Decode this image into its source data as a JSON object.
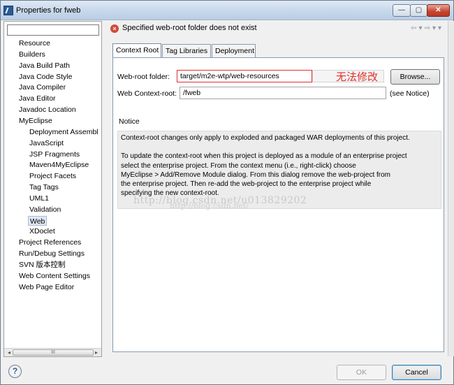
{
  "window": {
    "title": "Properties for fweb",
    "min_glyph": "—",
    "max_glyph": "▢",
    "close_glyph": "✕"
  },
  "sidebar": {
    "filter_placeholder": "",
    "items": [
      {
        "label": "Resource",
        "level": 0
      },
      {
        "label": "Builders",
        "level": 0
      },
      {
        "label": "Java Build Path",
        "level": 0
      },
      {
        "label": "Java Code Style",
        "level": 0
      },
      {
        "label": "Java Compiler",
        "level": 0
      },
      {
        "label": "Java Editor",
        "level": 0
      },
      {
        "label": "Javadoc Location",
        "level": 0
      },
      {
        "label": "MyEclipse",
        "level": 0
      },
      {
        "label": "Deployment Assembl",
        "level": 1
      },
      {
        "label": "JavaScript",
        "level": 1
      },
      {
        "label": "JSP Fragments",
        "level": 1
      },
      {
        "label": "Maven4MyEclipse",
        "level": 1
      },
      {
        "label": "Project Facets",
        "level": 1
      },
      {
        "label": "Tag Tags",
        "level": 1
      },
      {
        "label": "UML1",
        "level": 1
      },
      {
        "label": "Validation",
        "level": 1
      },
      {
        "label": "Web",
        "level": 1,
        "selected": true
      },
      {
        "label": "XDoclet",
        "level": 1
      },
      {
        "label": "Project References",
        "level": 0
      },
      {
        "label": "Run/Debug Settings",
        "level": 0
      },
      {
        "label": "SVN 版本控制",
        "level": 0
      },
      {
        "label": "Web Content Settings",
        "level": 0
      },
      {
        "label": "Web Page Editor",
        "level": 0
      }
    ],
    "scroll_thumb_label": "III"
  },
  "message": {
    "text": "Specified web-root folder does not exist",
    "icon": "error-icon"
  },
  "tabs": [
    "Context Root",
    "Tag Libraries",
    "Deployment"
  ],
  "form": {
    "webroot_label": "Web-root folder:",
    "webroot_value": "target/m2e-wtp/web-resources",
    "annotation": "无法修改",
    "browse_label": "Browse...",
    "context_label": "Web Context-root:",
    "context_value": "/fweb",
    "see_notice": "(see Notice)"
  },
  "notice": {
    "heading": "Notice",
    "lines": [
      "Context-root changes only apply to exploded and packaged WAR deployments of this project.",
      "",
      "To update the context-root when this project is deployed as a module of an enterprise project",
      "select the enterprise project. From the context menu (i.e., right-click) choose",
      "MyEclipse > Add/Remove Module dialog. From this dialog remove the web-project from",
      "the enterprise project. Then re-add the web-project to the enterprise project while",
      "specifying the new context-root."
    ],
    "watermark": "http://blog.csdn.net/u013829202",
    "watermark2": "http://blog.csdn.net/"
  },
  "footer": {
    "ok_label": "OK",
    "cancel_label": "Cancel",
    "help_glyph": "?"
  }
}
